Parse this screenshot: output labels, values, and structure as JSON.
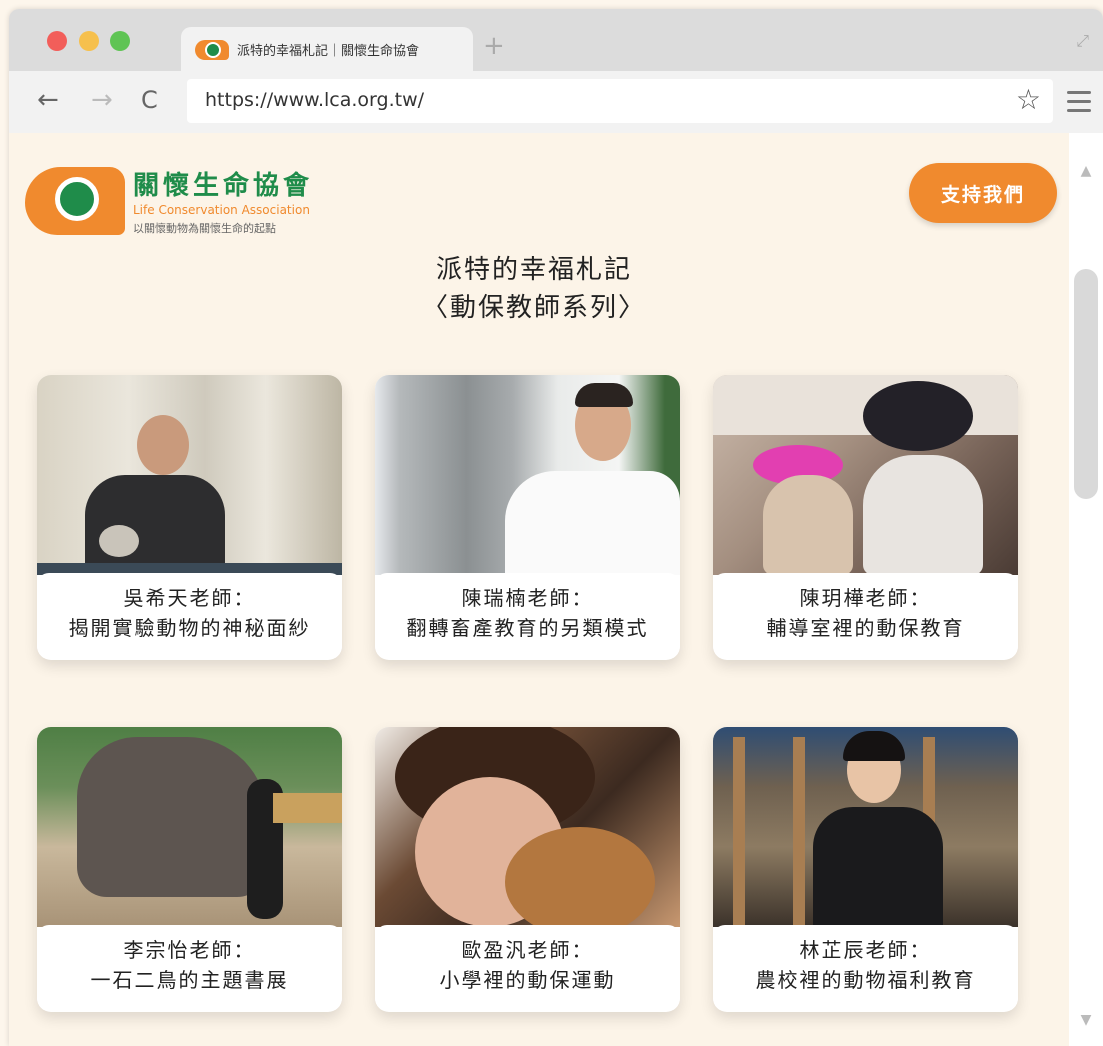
{
  "browser": {
    "tab_title": "派特的幸福札記｜關懷生命協會",
    "new_tab_icon": "plus-icon",
    "url": "https://www.lca.org.tw/"
  },
  "site": {
    "logo_cn": "關懷生命協會",
    "logo_en": "Life Conservation Association",
    "logo_tagline": "以關懷動物為關懷生命的起點",
    "support_button": "支持我們",
    "title_line1": "派特的幸福札記",
    "title_line2": "〈動保教師系列〉"
  },
  "cards": [
    {
      "line1": "吳希天老師：",
      "line2": "揭開實驗動物的神秘面紗"
    },
    {
      "line1": "陳瑞楠老師：",
      "line2": "翻轉畜產教育的另類模式"
    },
    {
      "line1": "陳玥樺老師：",
      "line2": "輔導室裡的動保教育"
    },
    {
      "line1": "李宗怡老師：",
      "line2": "一石二鳥的主題書展"
    },
    {
      "line1": "歐盈汎老師：",
      "line2": "小學裡的動保運動"
    },
    {
      "line1": "林芷辰老師：",
      "line2": "農校裡的動物福利教育"
    }
  ],
  "colors": {
    "accent_orange": "#f08a2e",
    "brand_green": "#1f8c4a",
    "page_background": "#fcf4e8"
  }
}
